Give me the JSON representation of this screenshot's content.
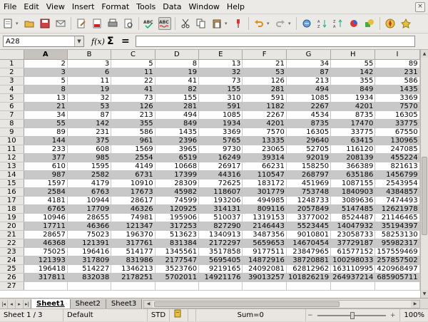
{
  "menu": {
    "items": [
      "File",
      "Edit",
      "View",
      "Insert",
      "Format",
      "Tools",
      "Data",
      "Window",
      "Help"
    ],
    "close_glyph": "×"
  },
  "toolbar": {
    "buttons": [
      "new-document-icon",
      "open-folder-icon",
      "save-icon",
      "email-icon",
      "edit-file-icon",
      "export-pdf-icon",
      "print-icon",
      "page-preview-icon",
      "spellcheck-icon",
      "autospellcheck-icon",
      "cut-icon",
      "copy-icon",
      "paste-icon",
      "format-paintbrush-icon",
      "undo-icon",
      "redo-icon",
      "hyperlink-icon",
      "sort-ascending-icon",
      "sort-descending-icon",
      "insert-chart-icon",
      "show-draw-functions-icon",
      "navigator-icon",
      "gallery-icon"
    ]
  },
  "formula_bar": {
    "name_box": "A28",
    "fx_label": "f(x)",
    "sum_label": "Σ",
    "equals_label": "=",
    "content": ""
  },
  "sheet": {
    "columns": [
      "A",
      "B",
      "C",
      "D",
      "E",
      "F",
      "G",
      "H",
      "I"
    ],
    "selected_column": "A",
    "rows": [
      {
        "n": "1",
        "cells": [
          "2",
          "3",
          "5",
          "8",
          "13",
          "21",
          "34",
          "55",
          "89"
        ]
      },
      {
        "n": "2",
        "cells": [
          "3",
          "6",
          "11",
          "19",
          "32",
          "53",
          "87",
          "142",
          "231"
        ]
      },
      {
        "n": "3",
        "cells": [
          "5",
          "11",
          "22",
          "41",
          "73",
          "126",
          "213",
          "355",
          "586"
        ]
      },
      {
        "n": "4",
        "cells": [
          "8",
          "19",
          "41",
          "82",
          "155",
          "281",
          "494",
          "849",
          "1435"
        ]
      },
      {
        "n": "5",
        "cells": [
          "13",
          "32",
          "73",
          "155",
          "310",
          "591",
          "1085",
          "1934",
          "3369"
        ]
      },
      {
        "n": "6",
        "cells": [
          "21",
          "53",
          "126",
          "281",
          "591",
          "1182",
          "2267",
          "4201",
          "7570"
        ]
      },
      {
        "n": "7",
        "cells": [
          "34",
          "87",
          "213",
          "494",
          "1085",
          "2267",
          "4534",
          "8735",
          "16305"
        ]
      },
      {
        "n": "8",
        "cells": [
          "55",
          "142",
          "355",
          "849",
          "1934",
          "4201",
          "8735",
          "17470",
          "33775"
        ]
      },
      {
        "n": "9",
        "cells": [
          "89",
          "231",
          "586",
          "1435",
          "3369",
          "7570",
          "16305",
          "33775",
          "67550"
        ]
      },
      {
        "n": "10",
        "cells": [
          "144",
          "375",
          "961",
          "2396",
          "5765",
          "13335",
          "29640",
          "63415",
          "130965"
        ]
      },
      {
        "n": "11",
        "cells": [
          "233",
          "608",
          "1569",
          "3965",
          "9730",
          "23065",
          "52705",
          "116120",
          "247085"
        ]
      },
      {
        "n": "12",
        "cells": [
          "377",
          "985",
          "2554",
          "6519",
          "16249",
          "39314",
          "92019",
          "208139",
          "455224"
        ]
      },
      {
        "n": "13",
        "cells": [
          "610",
          "1595",
          "4149",
          "10668",
          "26917",
          "66231",
          "158250",
          "366389",
          "821613"
        ]
      },
      {
        "n": "14",
        "cells": [
          "987",
          "2582",
          "6731",
          "17399",
          "44316",
          "110547",
          "268797",
          "635186",
          "1456799"
        ]
      },
      {
        "n": "15",
        "cells": [
          "1597",
          "4179",
          "10910",
          "28309",
          "72625",
          "183172",
          "451969",
          "1087155",
          "2543954"
        ]
      },
      {
        "n": "16",
        "cells": [
          "2584",
          "6763",
          "17673",
          "45982",
          "118607",
          "301779",
          "753748",
          "1840903",
          "4384857"
        ]
      },
      {
        "n": "17",
        "cells": [
          "4181",
          "10944",
          "28617",
          "74599",
          "193206",
          "494985",
          "1248733",
          "3089636",
          "7474493"
        ]
      },
      {
        "n": "18",
        "cells": [
          "6765",
          "17709",
          "46326",
          "120925",
          "314131",
          "809116",
          "2057849",
          "5147485",
          "12621978"
        ]
      },
      {
        "n": "19",
        "cells": [
          "10946",
          "28655",
          "74981",
          "195906",
          "510037",
          "1319153",
          "3377002",
          "8524487",
          "21146465"
        ]
      },
      {
        "n": "20",
        "cells": [
          "17711",
          "46366",
          "121347",
          "317253",
          "827290",
          "2146443",
          "5523445",
          "14047932",
          "35194397"
        ]
      },
      {
        "n": "21",
        "cells": [
          "28657",
          "75023",
          "196370",
          "513623",
          "1340913",
          "3487356",
          "9010801",
          "23058733",
          "58253130"
        ]
      },
      {
        "n": "22",
        "cells": [
          "46368",
          "121391",
          "317761",
          "831384",
          "2172297",
          "5659653",
          "14670454",
          "37729187",
          "95982317"
        ]
      },
      {
        "n": "23",
        "cells": [
          "75025",
          "196416",
          "514177",
          "1345561",
          "3517858",
          "9177511",
          "23847965",
          "61577152",
          "157559469"
        ]
      },
      {
        "n": "24",
        "cells": [
          "121393",
          "317809",
          "831986",
          "2177547",
          "5695405",
          "14872916",
          "38720881",
          "100298033",
          "257857502"
        ]
      },
      {
        "n": "25",
        "cells": [
          "196418",
          "514227",
          "1346213",
          "3523760",
          "9219165",
          "24092081",
          "62812962",
          "163110995",
          "420968497"
        ]
      },
      {
        "n": "26",
        "cells": [
          "317811",
          "832038",
          "2178251",
          "5702011",
          "14921176",
          "39013257",
          "101826219",
          "264937214",
          "685905711"
        ]
      },
      {
        "n": "27",
        "cells": [
          "",
          "",
          "",
          "",
          "",
          "",
          "",
          "",
          ""
        ]
      }
    ]
  },
  "sheet_tabs": {
    "nav": [
      "|◂",
      "◂",
      "▸",
      "▸|"
    ],
    "tabs": [
      "Sheet1",
      "Sheet2",
      "Sheet3"
    ],
    "active": "Sheet1"
  },
  "status_bar": {
    "sheet_info": "Sheet 1 / 3",
    "page_style": "Default",
    "mode": "STD",
    "selection_mode": "",
    "sum": "Sum=0",
    "zoom": "100%",
    "zoom_out": "−",
    "zoom_in": "+"
  }
}
